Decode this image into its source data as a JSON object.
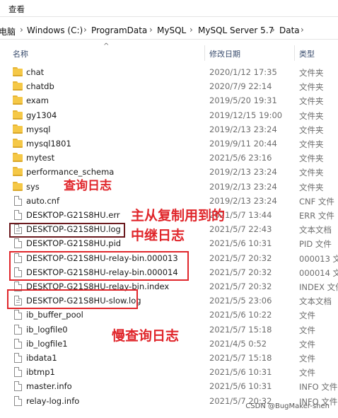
{
  "menu": {
    "view_label": "查看"
  },
  "breadcrumb": {
    "items": [
      "电脑",
      "Windows (C:)",
      "ProgramData",
      "MySQL",
      "MySQL Server 5.7",
      "Data"
    ],
    "separator": "›"
  },
  "columns": {
    "name": "名称",
    "date": "修改日期",
    "type": "类型",
    "sort_caret": "^"
  },
  "files": [
    {
      "name": "chat",
      "date": "2020/1/12 17:35",
      "type": "文件夹",
      "icon": "folder-icon"
    },
    {
      "name": "chatdb",
      "date": "2020/7/9 22:14",
      "type": "文件夹",
      "icon": "folder-icon"
    },
    {
      "name": "exam",
      "date": "2019/5/20 19:31",
      "type": "文件夹",
      "icon": "folder-icon"
    },
    {
      "name": "gy1304",
      "date": "2019/12/15 19:00",
      "type": "文件夹",
      "icon": "folder-icon"
    },
    {
      "name": "mysql",
      "date": "2019/2/13 23:24",
      "type": "文件夹",
      "icon": "folder-icon"
    },
    {
      "name": "mysql1801",
      "date": "2019/9/11 20:44",
      "type": "文件夹",
      "icon": "folder-icon"
    },
    {
      "name": "mytest",
      "date": "2021/5/6 23:16",
      "type": "文件夹",
      "icon": "folder-icon"
    },
    {
      "name": "performance_schema",
      "date": "2019/2/13 23:24",
      "type": "文件夹",
      "icon": "folder-icon"
    },
    {
      "name": "sys",
      "date": "2019/2/13 23:24",
      "type": "文件夹",
      "icon": "folder-icon"
    },
    {
      "name": "auto.cnf",
      "date": "2019/2/13 23:24",
      "type": "CNF 文件",
      "icon": "file-icon"
    },
    {
      "name": "DESKTOP-G21S8HU.err",
      "date": "2021/5/7 13:44",
      "type": "ERR 文件",
      "icon": "file-icon"
    },
    {
      "name": "DESKTOP-G21S8HU.log",
      "date": "2021/5/7 22:43",
      "type": "文本文档",
      "icon": "text-file-icon"
    },
    {
      "name": "DESKTOP-G21S8HU.pid",
      "date": "2021/5/6 10:31",
      "type": "PID 文件",
      "icon": "file-icon"
    },
    {
      "name": "DESKTOP-G21S8HU-relay-bin.000013",
      "date": "2021/5/7 20:32",
      "type": "000013 文",
      "icon": "file-icon"
    },
    {
      "name": "DESKTOP-G21S8HU-relay-bin.000014",
      "date": "2021/5/7 20:32",
      "type": "000014 文",
      "icon": "file-icon"
    },
    {
      "name": "DESKTOP-G21S8HU-relay-bin.index",
      "date": "2021/5/7 20:32",
      "type": "INDEX 文件",
      "icon": "file-icon"
    },
    {
      "name": "DESKTOP-G21S8HU-slow.log",
      "date": "2021/5/5 23:06",
      "type": "文本文档",
      "icon": "text-file-icon"
    },
    {
      "name": "ib_buffer_pool",
      "date": "2021/5/6 10:22",
      "type": "文件",
      "icon": "file-icon"
    },
    {
      "name": "ib_logfile0",
      "date": "2021/5/7 15:18",
      "type": "文件",
      "icon": "file-icon"
    },
    {
      "name": "ib_logfile1",
      "date": "2021/4/5 0:52",
      "type": "文件",
      "icon": "file-icon"
    },
    {
      "name": "ibdata1",
      "date": "2021/5/7 15:18",
      "type": "文件",
      "icon": "file-icon"
    },
    {
      "name": "ibtmp1",
      "date": "2021/5/6 10:31",
      "type": "文件",
      "icon": "file-icon"
    },
    {
      "name": "master.info",
      "date": "2021/5/6 10:31",
      "type": "INFO 文件",
      "icon": "file-icon"
    },
    {
      "name": "relay-log.info",
      "date": "2021/5/7 20:32",
      "type": "INFO 文件",
      "icon": "file-icon"
    }
  ],
  "annotations": {
    "query_log": "查询日志",
    "relay_log_line1": "主从复制用到的",
    "relay_log_line2": "中继日志",
    "slow_query_log": "慢查询日志",
    "color": "#e0262b"
  },
  "watermark": "CSDN @BugMaker-shen"
}
